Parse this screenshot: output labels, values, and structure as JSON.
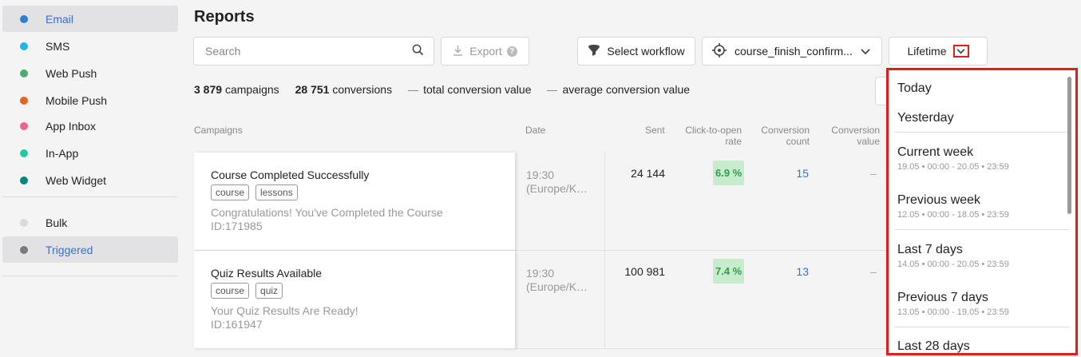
{
  "sidebar": {
    "items": [
      {
        "label": "Email",
        "color": "#2a7fd4",
        "active": true
      },
      {
        "label": "SMS",
        "color": "#1fb6e8"
      },
      {
        "label": "Web Push",
        "color": "#4caf6a"
      },
      {
        "label": "Mobile Push",
        "color": "#e8641e"
      },
      {
        "label": "App Inbox",
        "color": "#f06292"
      },
      {
        "label": "In-App",
        "color": "#26c6a6"
      },
      {
        "label": "Web Widget",
        "color": "#00897b"
      },
      {
        "label": "Bulk",
        "color": "#dadada"
      },
      {
        "label": "Triggered",
        "color": "#7a7a7a",
        "active": true
      }
    ]
  },
  "page": {
    "title": "Reports"
  },
  "toolbar": {
    "search_placeholder": "Search",
    "export_label": "Export",
    "export_help": "?",
    "workflow_label": "Select workflow",
    "trigger_value": "course_finish_confirm...",
    "period_label": "Lifetime"
  },
  "stats": {
    "campaigns_count": "3 879",
    "campaigns_label": "campaigns",
    "conversions_count": "28 751",
    "conversions_label": "conversions",
    "total_value_label": "total conversion value",
    "average_value_label": "average conversion value"
  },
  "table": {
    "headers": {
      "campaigns": "Campaigns",
      "date": "Date",
      "sent": "Sent",
      "ctor_1": "Click-to-open",
      "ctor_2": "rate",
      "conv_count_1": "Conversion",
      "conv_count_2": "count",
      "conv_value_1": "Conversion",
      "conv_value_2": "value"
    },
    "rows": [
      {
        "name": "Course Completed Successfully",
        "tags": [
          "course",
          "lessons"
        ],
        "subject": "Congratulations! You've Completed the Course",
        "id": "ID:171985",
        "time": "19:30",
        "tz": "(Europe/K…",
        "sent": "24 144",
        "rate": "6.9 %",
        "conv_count": "15",
        "conv_value": "–"
      },
      {
        "name": "Quiz Results Available",
        "tags": [
          "course",
          "quiz"
        ],
        "subject": "Your Quiz Results Are Ready!",
        "id": "ID:161947",
        "time": "19:30",
        "tz": "(Europe/K…",
        "sent": "100 981",
        "rate": "7.4 %",
        "conv_count": "13",
        "conv_value": "–"
      }
    ]
  },
  "period_dropdown": {
    "options": [
      {
        "label": "Today"
      },
      {
        "label": "Yesterday"
      },
      {
        "label": "Current week",
        "range": "19.05 • 00:00 - 20.05 • 23:59"
      },
      {
        "label": "Previous week",
        "range": "12.05 • 00:00 - 18.05 • 23:59"
      },
      {
        "label": "Last 7 days",
        "range": "14.05 • 00:00 - 20.05 • 23:59"
      },
      {
        "label": "Previous 7 days",
        "range": "13.05 • 00:00 - 19.05 • 23:59"
      },
      {
        "label": "Last 28 days"
      }
    ]
  },
  "colors": {
    "accent": "#3a70c7",
    "highlight": "#e31c1c",
    "rate_bg": "#c7ebcd",
    "rate_text": "#2f9e48"
  }
}
